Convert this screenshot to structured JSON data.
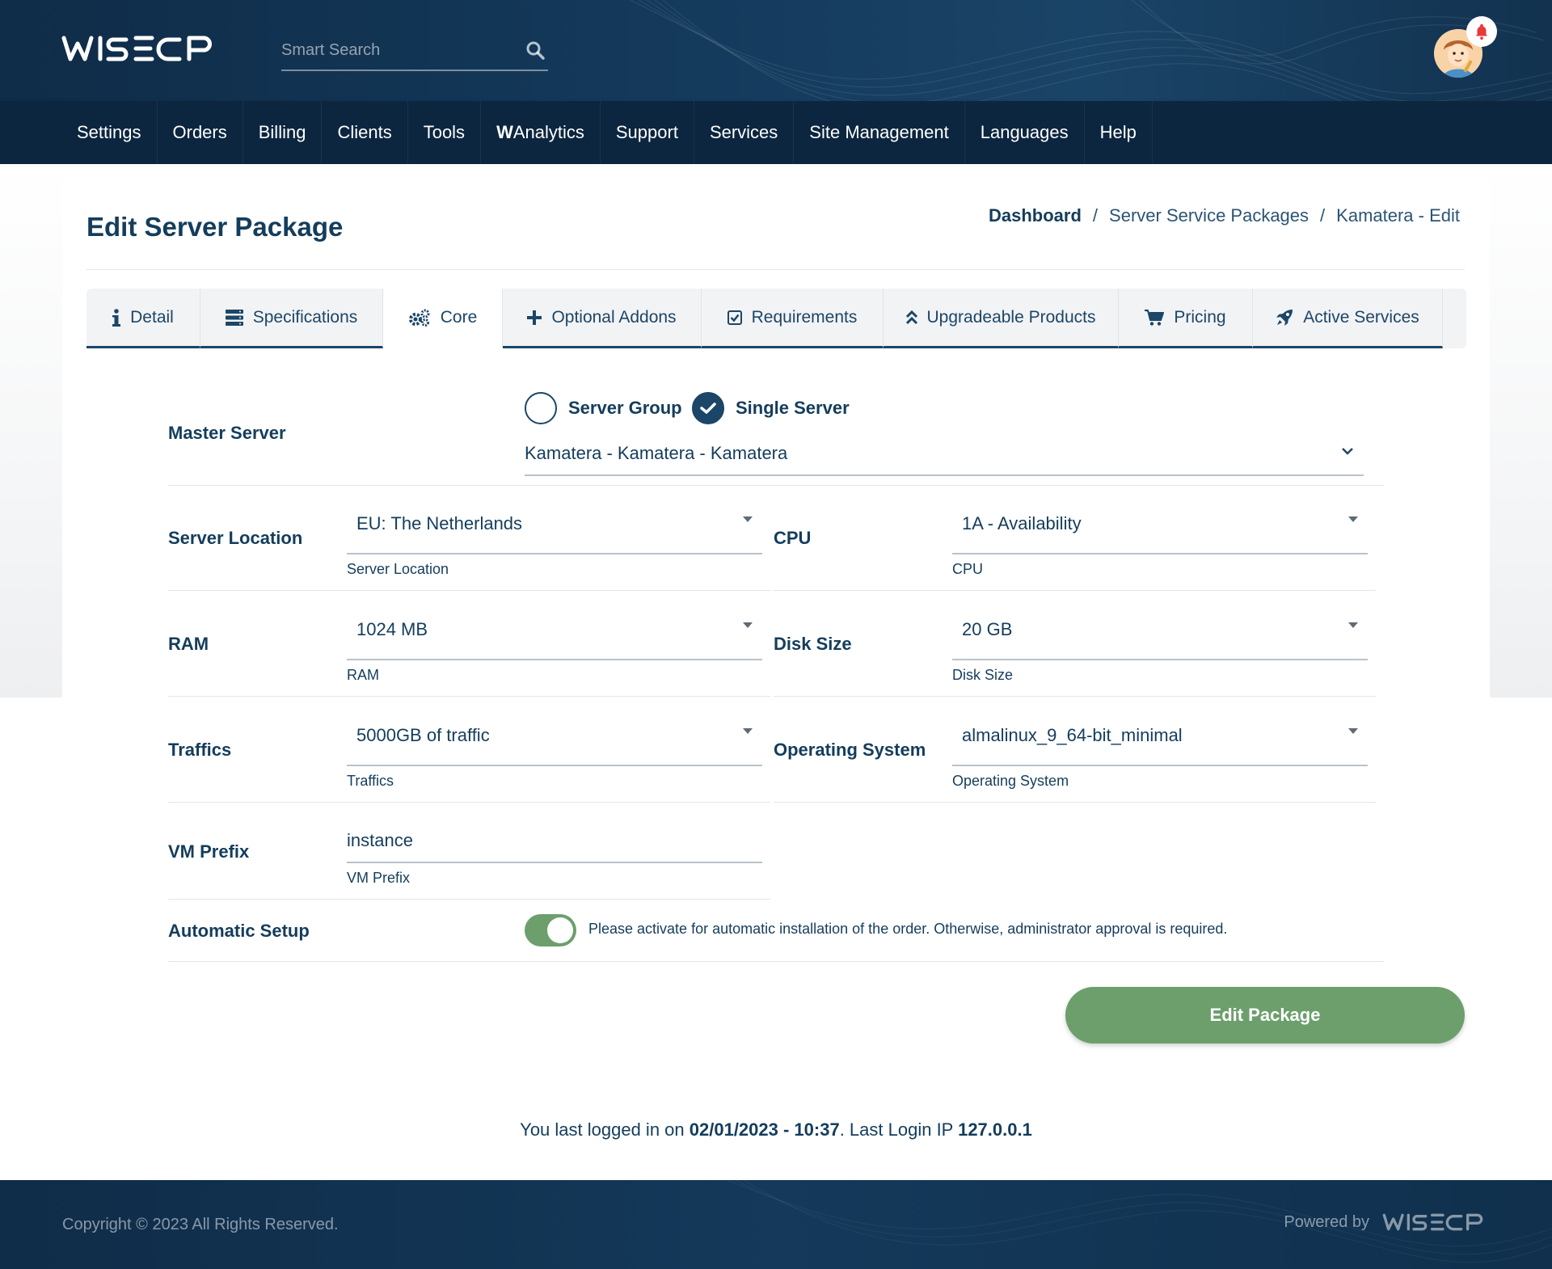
{
  "brand": {
    "name": "WISECP",
    "primary": "#143d5c",
    "header_bg": "#0f2c48",
    "nav_bg": "#0c2640",
    "accent_green": "#6c9f6c"
  },
  "search": {
    "placeholder": "Smart Search",
    "icon": "search-icon"
  },
  "user": {
    "avatar_icon": "user-avatar",
    "notification_icon": "bell-icon"
  },
  "nav": {
    "items": [
      {
        "label": "Settings"
      },
      {
        "label": "Orders"
      },
      {
        "label": "Billing"
      },
      {
        "label": "Clients"
      },
      {
        "label": "Tools"
      },
      {
        "label_bold": "W",
        "label": "Analytics"
      },
      {
        "label": "Support"
      },
      {
        "label": "Services"
      },
      {
        "label": "Site Management"
      },
      {
        "label": "Languages"
      },
      {
        "label": "Help"
      }
    ]
  },
  "page": {
    "title": "Edit Server Package",
    "breadcrumb": [
      {
        "label": "Dashboard"
      },
      {
        "label": "Server Service Packages"
      },
      {
        "label": "Kamatera - Edit"
      }
    ]
  },
  "tabs": [
    {
      "label": "Detail",
      "icon": "info-icon"
    },
    {
      "label": "Specifications",
      "icon": "server-icon"
    },
    {
      "label": "Core",
      "icon": "cogs-icon",
      "active": true
    },
    {
      "label": "Optional Addons",
      "icon": "plus-icon"
    },
    {
      "label": "Requirements",
      "icon": "checkbox-icon"
    },
    {
      "label": "Upgradeable Products",
      "icon": "double-chevron-up-icon"
    },
    {
      "label": "Pricing",
      "icon": "cart-icon"
    },
    {
      "label": "Active Services",
      "icon": "rocket-icon"
    }
  ],
  "form": {
    "master_server": {
      "label": "Master Server",
      "option_group": "Server Group",
      "option_single": "Single Server",
      "selected": "Single Server",
      "value": "Kamatera - Kamatera - Kamatera"
    },
    "server_location": {
      "label": "Server Location",
      "value": "EU: The Netherlands",
      "hint": "Server Location"
    },
    "cpu": {
      "label": "CPU",
      "value": "1A - Availability",
      "hint": "CPU"
    },
    "ram": {
      "label": "RAM",
      "value": "1024 MB",
      "hint": "RAM"
    },
    "disk_size": {
      "label": "Disk Size",
      "value": "20 GB",
      "hint": "Disk Size"
    },
    "traffics": {
      "label": "Traffics",
      "value": "5000GB of traffic",
      "hint": "Traffics"
    },
    "operating_system": {
      "label": "Operating System",
      "value": "almalinux_9_64-bit_minimal",
      "hint": "Operating System"
    },
    "vm_prefix": {
      "label": "VM Prefix",
      "value": "instance",
      "hint": "VM Prefix"
    },
    "automatic_setup": {
      "label": "Automatic Setup",
      "enabled": true,
      "description": "Please activate for automatic installation of the order. Otherwise, administrator approval is required."
    },
    "submit_label": "Edit Package"
  },
  "last_login": {
    "prefix": "You last logged in on ",
    "datetime": "02/01/2023 - 10:37",
    "middle": ". Last Login IP ",
    "ip": "127.0.0.1"
  },
  "footer": {
    "copyright": "Copyright © 2023 All Rights Reserved.",
    "powered_by": "Powered by",
    "powered_brand": "WISECP"
  }
}
